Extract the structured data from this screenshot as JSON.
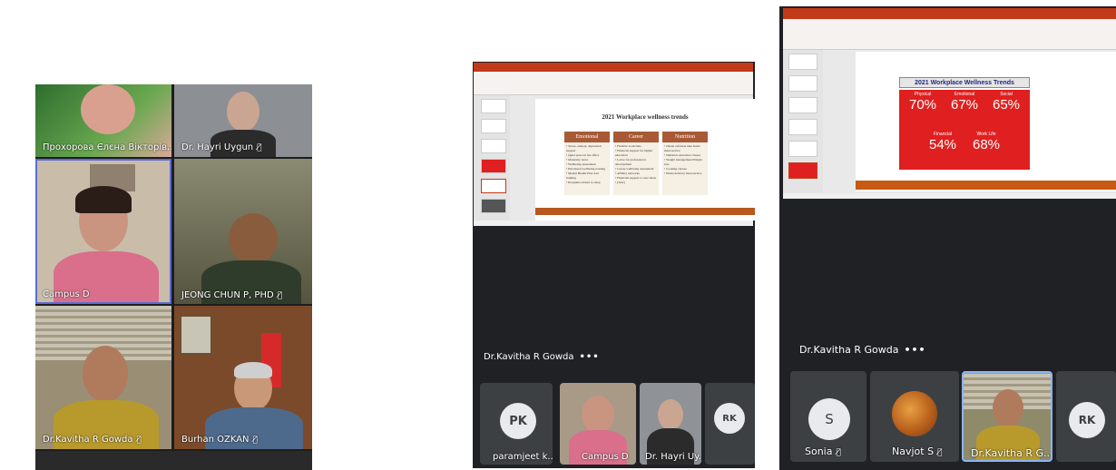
{
  "panel1": {
    "tiles": [
      {
        "name": "Прохорова Єлєна Вікторів...",
        "muted": true
      },
      {
        "name": "Dr. Hayri Uygun",
        "muted": true
      },
      {
        "name": "Campus D",
        "muted": false
      },
      {
        "name": "JEONG CHUN P, PHD",
        "muted": true
      },
      {
        "name": "Dr.Kavitha R Gowda",
        "muted": true
      },
      {
        "name": "Burhan OZKAN",
        "muted": true
      }
    ]
  },
  "panel2": {
    "slide": {
      "title": "2021 Workplace wellness trends",
      "columns": [
        {
          "heading": "Emotional",
          "items": [
            "Stress, anxiety, depression support",
            "Quiet space in the office",
            "Maternity leave",
            "Wellbeing assessment",
            "Emotional wellbeing training",
            "Mental Health First Aid training",
            "Programs related to sleep"
          ]
        },
        {
          "heading": "Career",
          "items": [
            "Flexible work time",
            "Financial support for higher education",
            "Leave for professional development",
            "Career wellbeing assessment",
            "Affinity networks",
            "Financial support to new ideas",
            "[Text]"
          ]
        },
        {
          "heading": "Nutrition",
          "items": [
            "Onsite cafeteria take home meal service",
            "Nutrition education classes",
            "Weight management/Weight loss",
            "Cooking classes",
            "Home delivery meal service"
          ]
        }
      ]
    },
    "presenter": "Dr.Kavitha R Gowda",
    "bottom": [
      {
        "initials": "PK",
        "name": "paramjeet k...",
        "muted": true
      },
      {
        "name": "Campus D"
      },
      {
        "name": "Dr. Hayri Uy..."
      },
      {
        "initials": "RK"
      }
    ]
  },
  "panel3": {
    "slide": {
      "title": "2021 Workplace Wellness Trends",
      "stats": [
        {
          "label": "Physical",
          "value": "70%"
        },
        {
          "label": "Emotional",
          "value": "67%"
        },
        {
          "label": "Social",
          "value": "65%"
        },
        {
          "label": "Financial",
          "value": "54%"
        },
        {
          "label": "Work Life",
          "value": "68%"
        }
      ]
    },
    "presenter": "Dr.Kavitha R Gowda",
    "bottom": [
      {
        "initials": "S",
        "name": "Sonia",
        "muted": true
      },
      {
        "name": "Navjot S",
        "muted": true
      },
      {
        "name": "Dr.Kavitha R G..."
      },
      {
        "initials": "RK"
      }
    ]
  },
  "colors": {
    "ppt_red": "#c23a1a",
    "meet_dark": "#202124",
    "slide_red": "#e02020",
    "column_brown": "#a75a35"
  }
}
